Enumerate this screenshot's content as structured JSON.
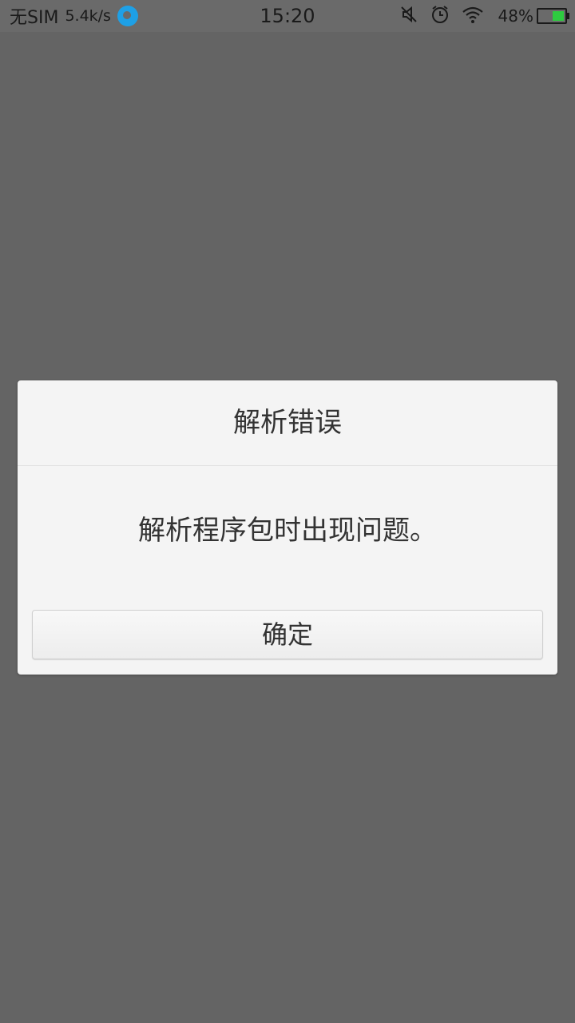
{
  "status_bar": {
    "carrier": "无SIM",
    "network_speed": "5.4k/s",
    "time": "15:20",
    "battery_percent": "48%",
    "icons": [
      "app-notification-icon",
      "mute-icon",
      "alarm-icon",
      "wifi-icon",
      "battery-icon"
    ]
  },
  "dialog": {
    "title": "解析错误",
    "message": "解析程序包时出现问题。",
    "confirm_label": "确定"
  },
  "colors": {
    "overlay": "#646464",
    "dialog_bg": "#f4f4f4",
    "battery_fill": "#2ecc40",
    "app_icon": "#1ea0e6"
  }
}
